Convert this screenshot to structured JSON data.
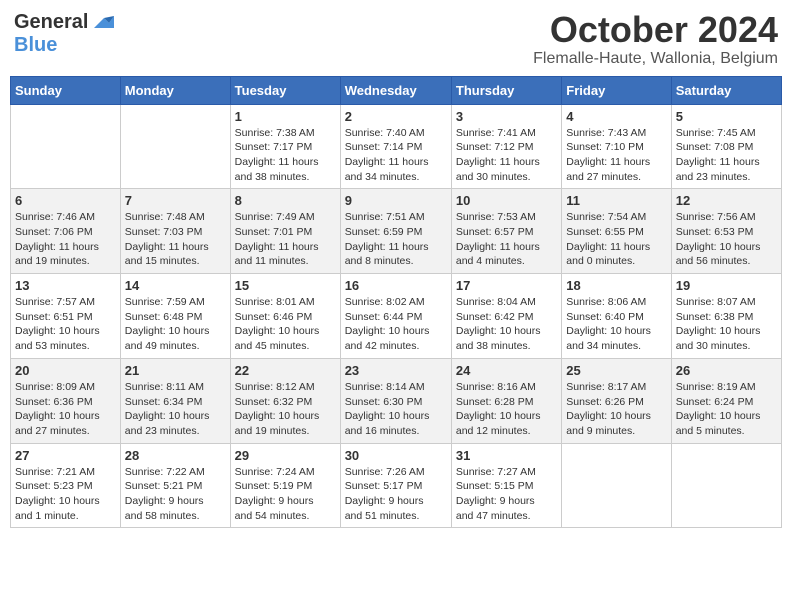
{
  "logo": {
    "general": "General",
    "blue": "Blue"
  },
  "title": {
    "month": "October 2024",
    "location": "Flemalle-Haute, Wallonia, Belgium"
  },
  "weekdays": [
    "Sunday",
    "Monday",
    "Tuesday",
    "Wednesday",
    "Thursday",
    "Friday",
    "Saturday"
  ],
  "weeks": [
    {
      "rowClass": "week-row-1",
      "days": [
        {
          "number": "",
          "info": "",
          "empty": true
        },
        {
          "number": "",
          "info": "",
          "empty": true
        },
        {
          "number": "1",
          "info": "Sunrise: 7:38 AM\nSunset: 7:17 PM\nDaylight: 11 hours\nand 38 minutes.",
          "empty": false
        },
        {
          "number": "2",
          "info": "Sunrise: 7:40 AM\nSunset: 7:14 PM\nDaylight: 11 hours\nand 34 minutes.",
          "empty": false
        },
        {
          "number": "3",
          "info": "Sunrise: 7:41 AM\nSunset: 7:12 PM\nDaylight: 11 hours\nand 30 minutes.",
          "empty": false
        },
        {
          "number": "4",
          "info": "Sunrise: 7:43 AM\nSunset: 7:10 PM\nDaylight: 11 hours\nand 27 minutes.",
          "empty": false
        },
        {
          "number": "5",
          "info": "Sunrise: 7:45 AM\nSunset: 7:08 PM\nDaylight: 11 hours\nand 23 minutes.",
          "empty": false
        }
      ]
    },
    {
      "rowClass": "week-row-2",
      "days": [
        {
          "number": "6",
          "info": "Sunrise: 7:46 AM\nSunset: 7:06 PM\nDaylight: 11 hours\nand 19 minutes.",
          "empty": false
        },
        {
          "number": "7",
          "info": "Sunrise: 7:48 AM\nSunset: 7:03 PM\nDaylight: 11 hours\nand 15 minutes.",
          "empty": false
        },
        {
          "number": "8",
          "info": "Sunrise: 7:49 AM\nSunset: 7:01 PM\nDaylight: 11 hours\nand 11 minutes.",
          "empty": false
        },
        {
          "number": "9",
          "info": "Sunrise: 7:51 AM\nSunset: 6:59 PM\nDaylight: 11 hours\nand 8 minutes.",
          "empty": false
        },
        {
          "number": "10",
          "info": "Sunrise: 7:53 AM\nSunset: 6:57 PM\nDaylight: 11 hours\nand 4 minutes.",
          "empty": false
        },
        {
          "number": "11",
          "info": "Sunrise: 7:54 AM\nSunset: 6:55 PM\nDaylight: 11 hours\nand 0 minutes.",
          "empty": false
        },
        {
          "number": "12",
          "info": "Sunrise: 7:56 AM\nSunset: 6:53 PM\nDaylight: 10 hours\nand 56 minutes.",
          "empty": false
        }
      ]
    },
    {
      "rowClass": "week-row-3",
      "days": [
        {
          "number": "13",
          "info": "Sunrise: 7:57 AM\nSunset: 6:51 PM\nDaylight: 10 hours\nand 53 minutes.",
          "empty": false
        },
        {
          "number": "14",
          "info": "Sunrise: 7:59 AM\nSunset: 6:48 PM\nDaylight: 10 hours\nand 49 minutes.",
          "empty": false
        },
        {
          "number": "15",
          "info": "Sunrise: 8:01 AM\nSunset: 6:46 PM\nDaylight: 10 hours\nand 45 minutes.",
          "empty": false
        },
        {
          "number": "16",
          "info": "Sunrise: 8:02 AM\nSunset: 6:44 PM\nDaylight: 10 hours\nand 42 minutes.",
          "empty": false
        },
        {
          "number": "17",
          "info": "Sunrise: 8:04 AM\nSunset: 6:42 PM\nDaylight: 10 hours\nand 38 minutes.",
          "empty": false
        },
        {
          "number": "18",
          "info": "Sunrise: 8:06 AM\nSunset: 6:40 PM\nDaylight: 10 hours\nand 34 minutes.",
          "empty": false
        },
        {
          "number": "19",
          "info": "Sunrise: 8:07 AM\nSunset: 6:38 PM\nDaylight: 10 hours\nand 30 minutes.",
          "empty": false
        }
      ]
    },
    {
      "rowClass": "week-row-4",
      "days": [
        {
          "number": "20",
          "info": "Sunrise: 8:09 AM\nSunset: 6:36 PM\nDaylight: 10 hours\nand 27 minutes.",
          "empty": false
        },
        {
          "number": "21",
          "info": "Sunrise: 8:11 AM\nSunset: 6:34 PM\nDaylight: 10 hours\nand 23 minutes.",
          "empty": false
        },
        {
          "number": "22",
          "info": "Sunrise: 8:12 AM\nSunset: 6:32 PM\nDaylight: 10 hours\nand 19 minutes.",
          "empty": false
        },
        {
          "number": "23",
          "info": "Sunrise: 8:14 AM\nSunset: 6:30 PM\nDaylight: 10 hours\nand 16 minutes.",
          "empty": false
        },
        {
          "number": "24",
          "info": "Sunrise: 8:16 AM\nSunset: 6:28 PM\nDaylight: 10 hours\nand 12 minutes.",
          "empty": false
        },
        {
          "number": "25",
          "info": "Sunrise: 8:17 AM\nSunset: 6:26 PM\nDaylight: 10 hours\nand 9 minutes.",
          "empty": false
        },
        {
          "number": "26",
          "info": "Sunrise: 8:19 AM\nSunset: 6:24 PM\nDaylight: 10 hours\nand 5 minutes.",
          "empty": false
        }
      ]
    },
    {
      "rowClass": "week-row-5",
      "days": [
        {
          "number": "27",
          "info": "Sunrise: 7:21 AM\nSunset: 5:23 PM\nDaylight: 10 hours\nand 1 minute.",
          "empty": false
        },
        {
          "number": "28",
          "info": "Sunrise: 7:22 AM\nSunset: 5:21 PM\nDaylight: 9 hours\nand 58 minutes.",
          "empty": false
        },
        {
          "number": "29",
          "info": "Sunrise: 7:24 AM\nSunset: 5:19 PM\nDaylight: 9 hours\nand 54 minutes.",
          "empty": false
        },
        {
          "number": "30",
          "info": "Sunrise: 7:26 AM\nSunset: 5:17 PM\nDaylight: 9 hours\nand 51 minutes.",
          "empty": false
        },
        {
          "number": "31",
          "info": "Sunrise: 7:27 AM\nSunset: 5:15 PM\nDaylight: 9 hours\nand 47 minutes.",
          "empty": false
        },
        {
          "number": "",
          "info": "",
          "empty": true
        },
        {
          "number": "",
          "info": "",
          "empty": true
        }
      ]
    }
  ]
}
